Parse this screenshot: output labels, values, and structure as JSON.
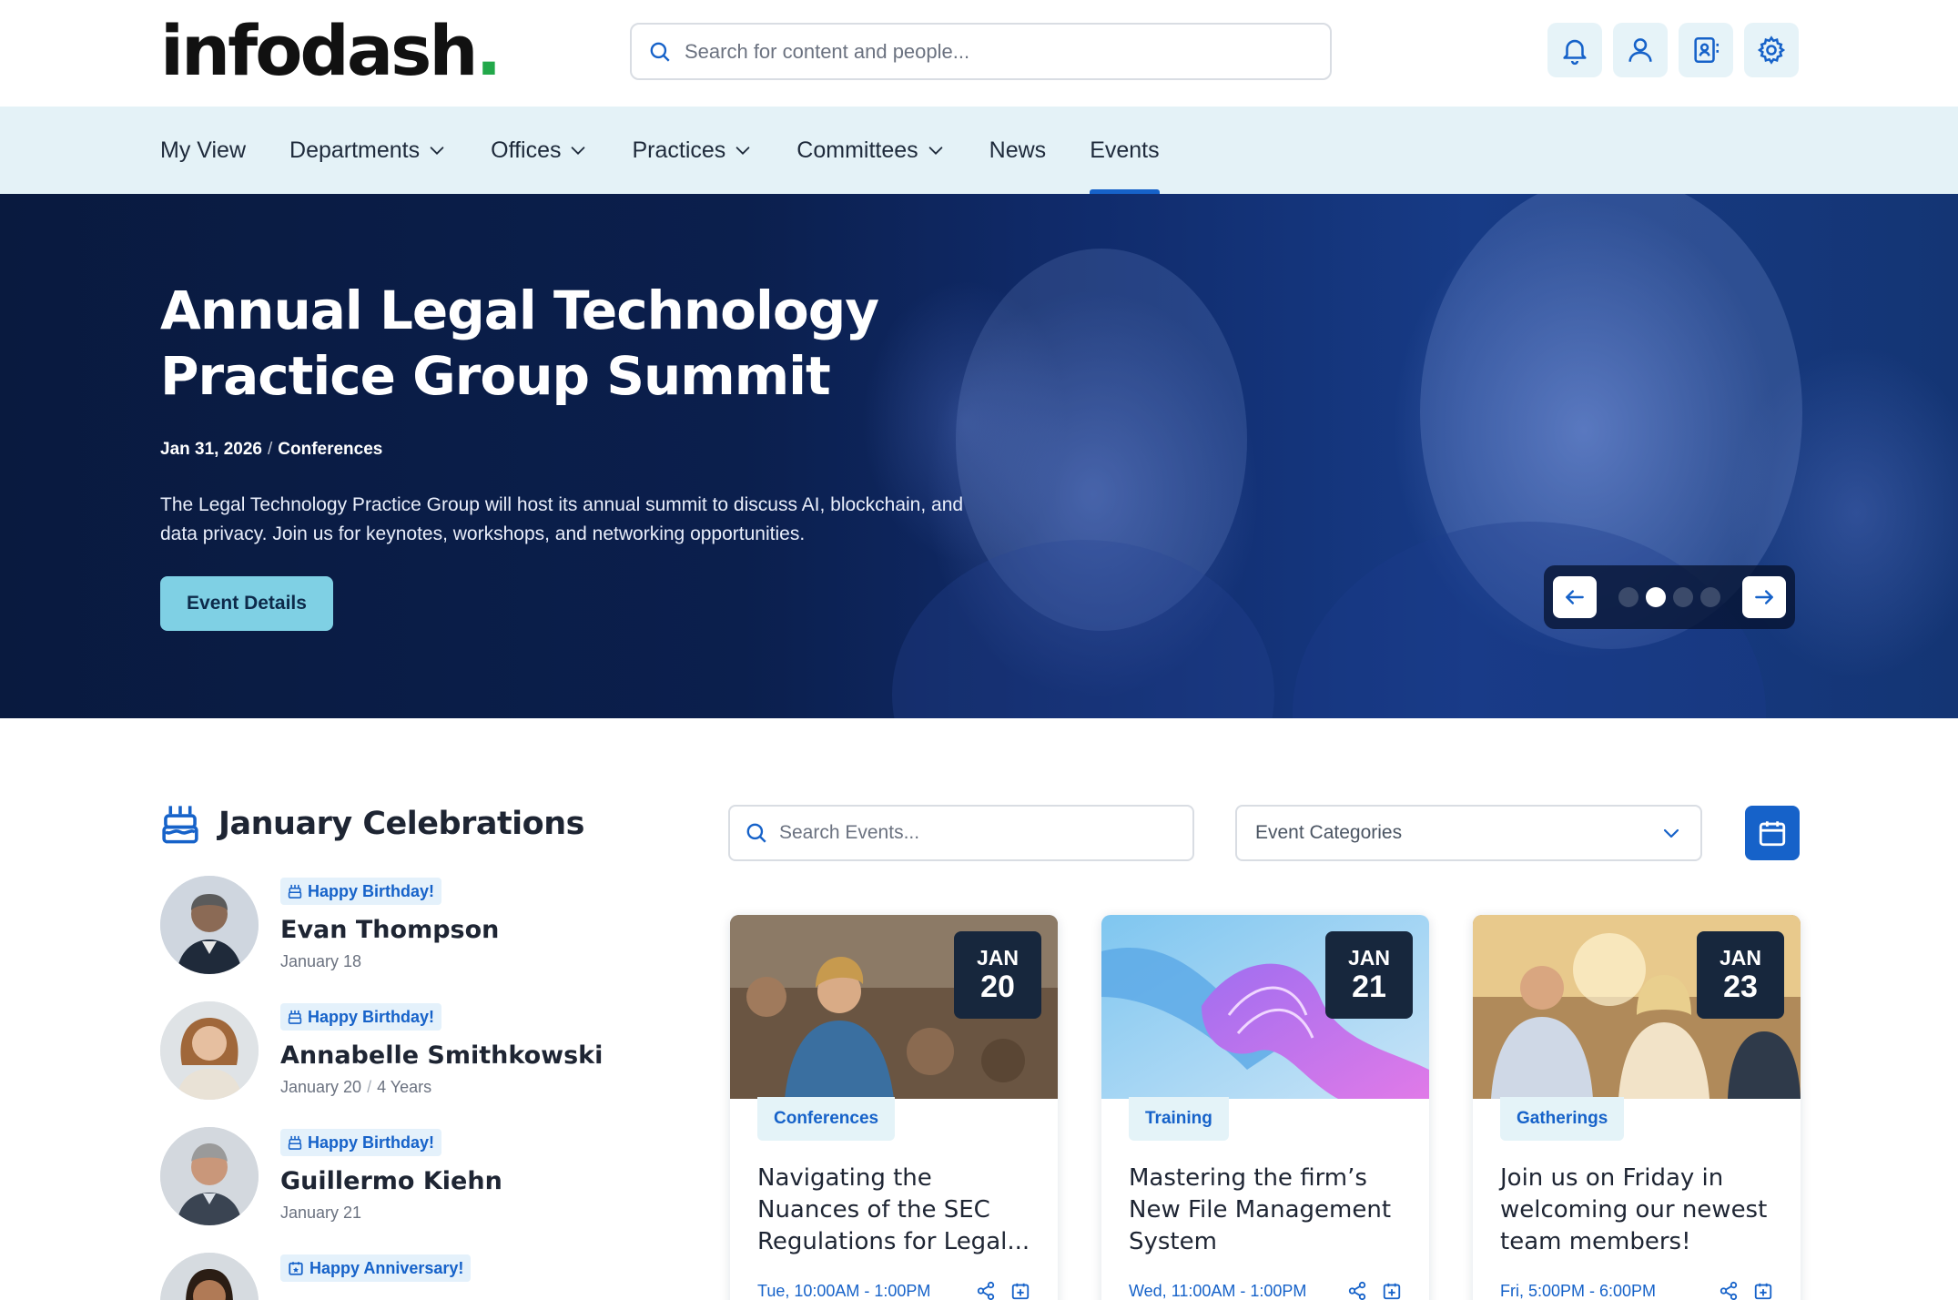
{
  "brand": {
    "name": "infodash",
    "dot": ".",
    "accent": "#22a84a"
  },
  "search": {
    "placeholder": "Search for content and people..."
  },
  "header_icons": [
    "bell-icon",
    "user-icon",
    "contacts-icon",
    "gear-icon"
  ],
  "nav": {
    "items": [
      {
        "label": "My View",
        "dropdown": false
      },
      {
        "label": "Departments",
        "dropdown": true
      },
      {
        "label": "Offices",
        "dropdown": true
      },
      {
        "label": "Practices",
        "dropdown": true
      },
      {
        "label": "Committees",
        "dropdown": true
      },
      {
        "label": "News",
        "dropdown": false
      },
      {
        "label": "Events",
        "dropdown": false,
        "active": true
      }
    ]
  },
  "hero": {
    "title": "Annual Legal Technology Practice Group Summit",
    "date": "Jan 31, 2026",
    "separator": "/",
    "category": "Conferences",
    "description": "The Legal Technology Practice Group will host its annual summit to discuss AI, blockchain, and data privacy. Join us for keynotes, workshops, and networking opportunities.",
    "button": "Event Details",
    "slide_count": 4,
    "active_slide": 2
  },
  "celebrations": {
    "title": "January Celebrations",
    "people": [
      {
        "badge": "Happy Birthday!",
        "name": "Evan Thompson",
        "date": "January 18",
        "extra": ""
      },
      {
        "badge": "Happy Birthday!",
        "name": "Annabelle Smithkowski",
        "date": "January 20",
        "extra": "4 Years"
      },
      {
        "badge": "Happy Birthday!",
        "name": "Guillermo Kiehn",
        "date": "January 21",
        "extra": ""
      },
      {
        "badge": "Happy Anniversary!",
        "name": "",
        "date": "",
        "extra": ""
      }
    ]
  },
  "events": {
    "search_placeholder": "Search Events...",
    "category_placeholder": "Event Categories",
    "cards": [
      {
        "month": "JAN",
        "day": "20",
        "category": "Conferences",
        "title": "Navigating the Nuances of the SEC Regulations for Legal...",
        "time": "Tue, 10:00AM - 1:00PM"
      },
      {
        "month": "JAN",
        "day": "21",
        "category": "Training",
        "title": "Mastering the firm’s New File Management System",
        "time": "Wed, 11:00AM - 1:00PM"
      },
      {
        "month": "JAN",
        "day": "23",
        "category": "Gatherings",
        "title": "Join us on Friday in welcoming our newest team members!",
        "time": "Fri, 5:00PM - 6:00PM"
      }
    ]
  },
  "colors": {
    "primary": "#1662c9",
    "nav_bg": "#e4f2f7",
    "hero_button": "#7fd0e4",
    "date_box": "#17273d"
  }
}
